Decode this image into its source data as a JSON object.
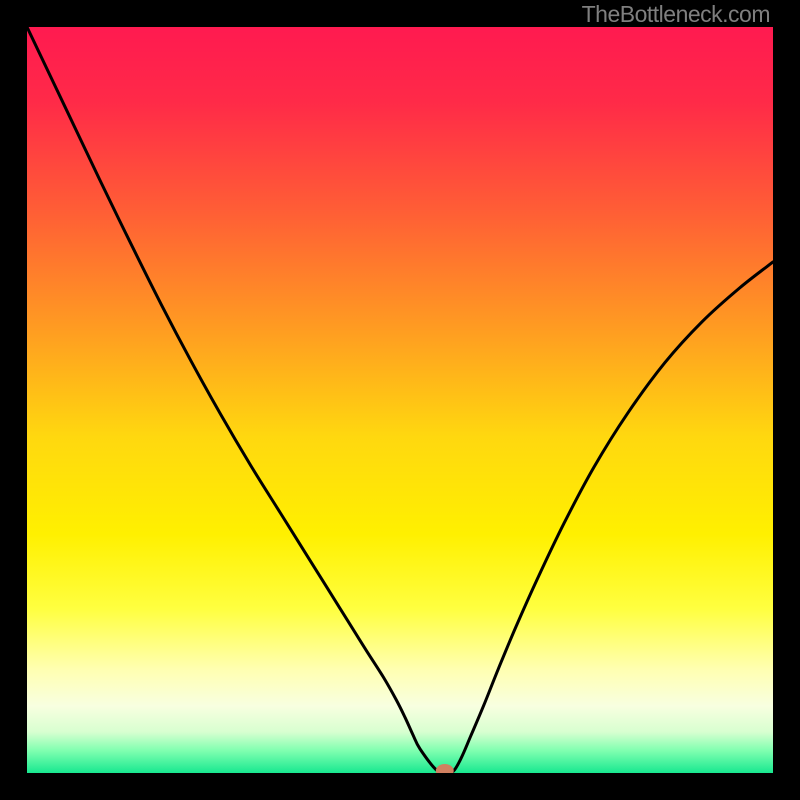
{
  "watermark": "TheBottleneck.com",
  "chart_data": {
    "type": "line",
    "title": "",
    "xlabel": "",
    "ylabel": "",
    "xlim": [
      0,
      1
    ],
    "ylim": [
      0,
      1
    ],
    "background_gradient": {
      "stops": [
        {
          "offset": 0.0,
          "color": "#ff1a50"
        },
        {
          "offset": 0.1,
          "color": "#ff2a48"
        },
        {
          "offset": 0.25,
          "color": "#ff5f35"
        },
        {
          "offset": 0.4,
          "color": "#ff9a22"
        },
        {
          "offset": 0.55,
          "color": "#ffd80f"
        },
        {
          "offset": 0.68,
          "color": "#fff000"
        },
        {
          "offset": 0.78,
          "color": "#ffff40"
        },
        {
          "offset": 0.86,
          "color": "#ffffb0"
        },
        {
          "offset": 0.91,
          "color": "#f8ffe0"
        },
        {
          "offset": 0.945,
          "color": "#d8ffd0"
        },
        {
          "offset": 0.97,
          "color": "#80ffb0"
        },
        {
          "offset": 1.0,
          "color": "#18e890"
        }
      ]
    },
    "curve": {
      "x": [
        0.0,
        0.05,
        0.1,
        0.14,
        0.18,
        0.22,
        0.26,
        0.3,
        0.34,
        0.375,
        0.405,
        0.43,
        0.455,
        0.478,
        0.495,
        0.507,
        0.517,
        0.527,
        0.55,
        0.564,
        0.572,
        0.582,
        0.595,
        0.612,
        0.632,
        0.655,
        0.685,
        0.72,
        0.76,
        0.805,
        0.855,
        0.905,
        0.955,
        1.0
      ],
      "y": [
        1.0,
        0.895,
        0.79,
        0.708,
        0.628,
        0.552,
        0.48,
        0.412,
        0.348,
        0.292,
        0.244,
        0.204,
        0.164,
        0.128,
        0.098,
        0.074,
        0.052,
        0.032,
        0.003,
        0.003,
        0.003,
        0.02,
        0.05,
        0.09,
        0.14,
        0.195,
        0.262,
        0.335,
        0.41,
        0.482,
        0.55,
        0.605,
        0.65,
        0.685
      ]
    },
    "marker": {
      "x": 0.56,
      "y": 0.003,
      "color": "#d08060",
      "rx": 0.012,
      "ry": 0.009
    }
  }
}
